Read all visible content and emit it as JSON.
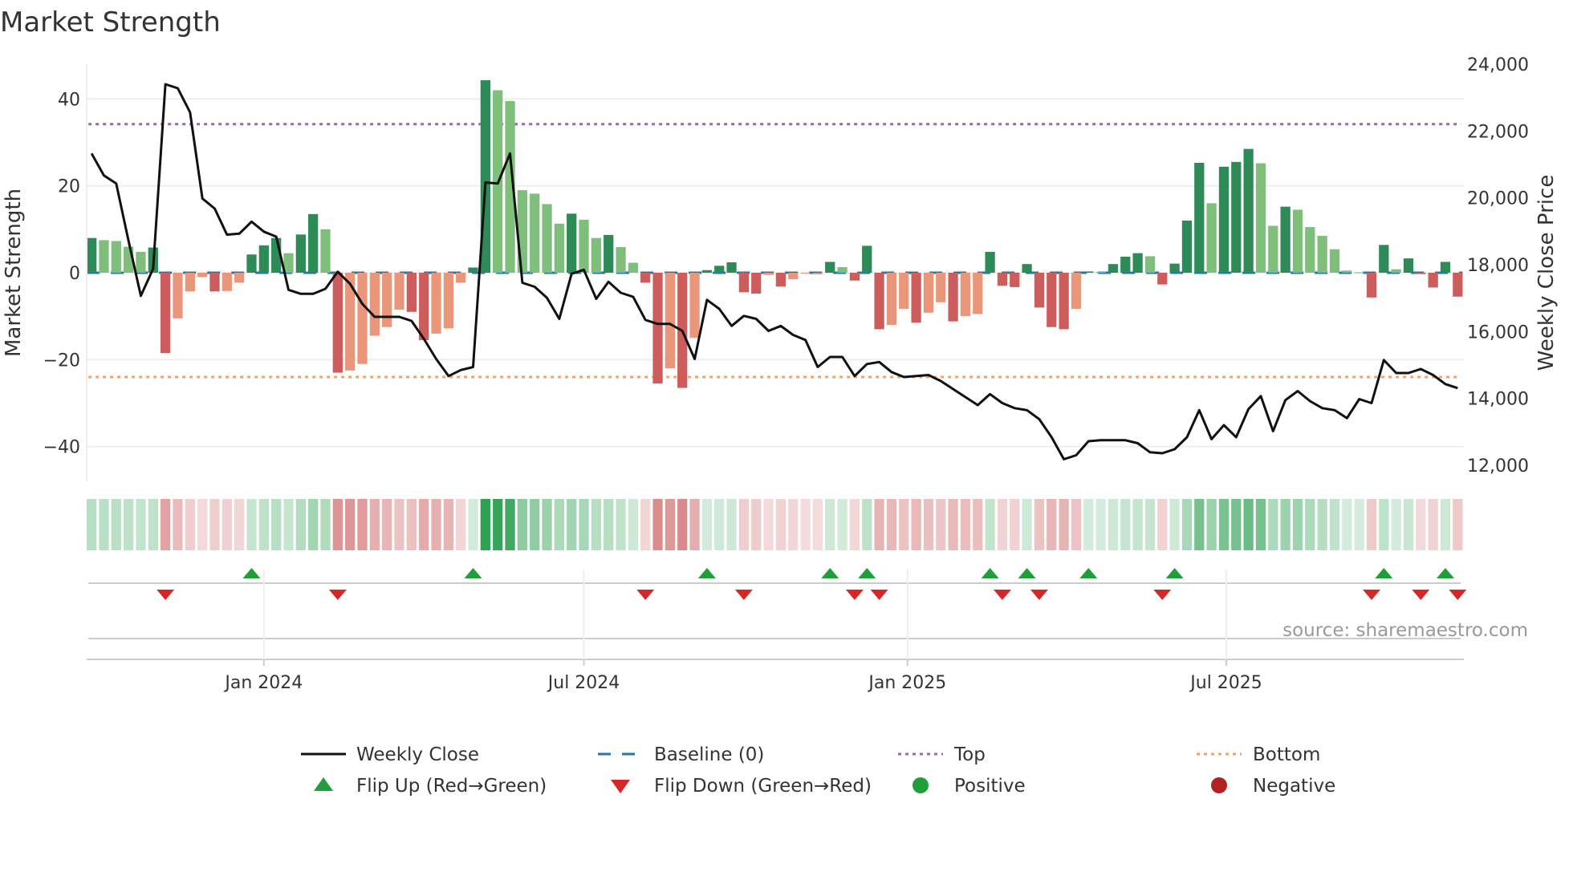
{
  "chart_data": {
    "type": "bar",
    "title": "Market Strength",
    "ylabel": "Market Strength",
    "y2label": "Weekly Close Price",
    "ylim": [
      -48,
      48
    ],
    "y2lim": [
      11520,
      24000
    ],
    "xlim": [
      -0.4,
      111.5
    ],
    "yticks": [
      -40,
      -20,
      0,
      20,
      40
    ],
    "yticklabels": [
      "−40",
      "−20",
      "0",
      "20",
      "40"
    ],
    "y2ticks": [
      12000,
      14000,
      16000,
      18000,
      20000,
      22000,
      24000
    ],
    "y2ticklabels": [
      "12,000",
      "14,000",
      "16,000",
      "18,000",
      "20,000",
      "22,000",
      "24,000"
    ],
    "xticks": [
      {
        "pos": 14,
        "label": "Jan 2024"
      },
      {
        "pos": 40,
        "label": "Jul 2024"
      },
      {
        "pos": 66.3,
        "label": "Jan 2025"
      },
      {
        "pos": 92.2,
        "label": "Jul 2025"
      }
    ],
    "top_threshold": 34.2,
    "bottom_threshold": -24,
    "baseline": 0,
    "strength": [
      8,
      7.5,
      7.3,
      6,
      4.8,
      5.8,
      -18.5,
      -10.5,
      -4.3,
      -1,
      -4.3,
      -4.2,
      -2.3,
      4.2,
      6.3,
      8,
      4.5,
      8.8,
      13.5,
      10,
      -23,
      -22.5,
      -21,
      -14.5,
      -12.5,
      -8.5,
      -9,
      -15.5,
      -14,
      -12.8,
      -2.3,
      1.2,
      44.3,
      42,
      39.5,
      19,
      18.2,
      15.8,
      11.3,
      13.6,
      12.2,
      8,
      8.7,
      5.9,
      2.3,
      -2.3,
      -25.5,
      -22,
      -26.5,
      -15,
      0.6,
      1.6,
      2.4,
      -4.5,
      -4.8,
      -0.5,
      -3.2,
      -1.5,
      -0.2,
      -0.1,
      2.5,
      1.3,
      -1.8,
      6.2,
      -13,
      -12,
      -8.3,
      -11.5,
      -9.2,
      -6.8,
      -11.2,
      -10,
      -9.5,
      4.8,
      -3,
      -3.3,
      2,
      -8,
      -12.5,
      -13,
      -8.3,
      0.3,
      0.2,
      2,
      3.7,
      4.5,
      3.8,
      -2.7,
      2.1,
      12,
      25.3,
      16,
      24.4,
      25.5,
      28.5,
      25.2,
      10.8,
      15.2,
      14.5,
      10.5,
      8.5,
      5.4,
      0.5,
      0.1,
      -5.7,
      6.4,
      0.8,
      3.3,
      -0.3,
      -3.4,
      2.5,
      -5.5
    ],
    "weekly_close": [
      21330,
      20670,
      20430,
      18720,
      17070,
      17880,
      23400,
      23280,
      22560,
      19980,
      19680,
      18900,
      18930,
      19290,
      18990,
      18840,
      17250,
      17130,
      17130,
      17280,
      17790,
      17430,
      16830,
      16440,
      16440,
      16440,
      16320,
      15780,
      15180,
      14670,
      14850,
      14940,
      20460,
      20430,
      21330,
      17460,
      17340,
      17010,
      16380,
      17730,
      17850,
      16980,
      17490,
      17160,
      17040,
      16350,
      16230,
      16230,
      16020,
      15180,
      16950,
      16680,
      16170,
      16470,
      16380,
      16020,
      16170,
      15900,
      15750,
      14940,
      15240,
      15240,
      14670,
      15030,
      15090,
      14790,
      14640,
      14670,
      14700,
      14520,
      14280,
      14040,
      13800,
      14130,
      13860,
      13710,
      13650,
      13380,
      12840,
      12180,
      12300,
      12720,
      12750,
      12750,
      12750,
      12660,
      12390,
      12360,
      12480,
      12840,
      13650,
      12780,
      13200,
      12840,
      13680,
      14070,
      13020,
      13950,
      14220,
      13920,
      13710,
      13650,
      13410,
      13980,
      13860,
      15150,
      14760,
      14760,
      14880,
      14700,
      14430,
      14310
    ],
    "legend": {
      "placement": "bottom-center",
      "items": [
        {
          "label": "Weekly Close",
          "kind": "line"
        },
        {
          "label": "Baseline (0)",
          "kind": "dash"
        },
        {
          "label": "Top",
          "kind": "dot-purple"
        },
        {
          "label": "Bottom",
          "kind": "dot-orange"
        },
        {
          "label": "Flip Up (Red→Green)",
          "kind": "tri-up"
        },
        {
          "label": "Flip Down (Green→Red)",
          "kind": "tri-down"
        },
        {
          "label": "Positive",
          "kind": "dot-green"
        },
        {
          "label": "Negative",
          "kind": "dot-red"
        }
      ]
    },
    "source": "source: sharemaestro.com",
    "colors": {
      "pos_strong": "#2e8b57",
      "pos_weak": "#7fbf7b",
      "neg_strong": "#cd5c5c",
      "neg_weak": "#e9967a",
      "line": "#111111",
      "baseline": "#1f77b4",
      "top": "#9467bd",
      "bottom": "#f4a261",
      "flip_up": "#1f9e3a",
      "flip_down": "#d62728",
      "positive": "#1f9e3a",
      "negative": "#b22222"
    }
  }
}
